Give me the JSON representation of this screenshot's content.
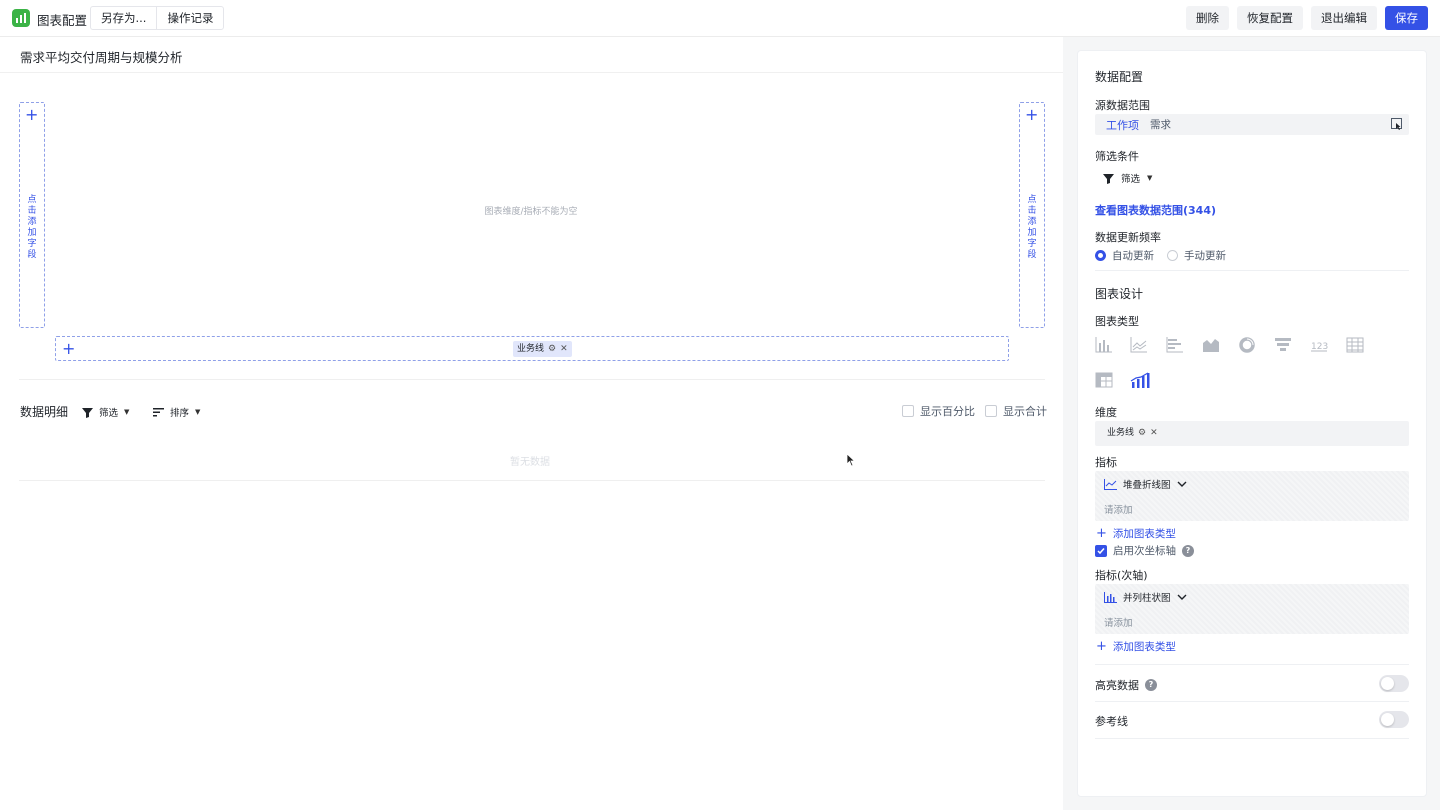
{
  "topbar": {
    "app_title": "图表配置",
    "save_as": "另存为...",
    "history": "操作记录",
    "delete": "删除",
    "restore": "恢复配置",
    "exit": "退出编辑",
    "save": "保存",
    "accent": "#3451e6"
  },
  "canvas": {
    "chart_title": "需求平均交付周期与规模分析",
    "left_axis_hint": "点击添加字段",
    "right_axis_hint": "点击添加字段",
    "empty_message": "图表维度/指标不能为空",
    "x_field_chip": "业务线"
  },
  "detail": {
    "title": "数据明细",
    "filter": "筛选",
    "sort": "排序",
    "show_percent": "显示百分比",
    "show_total": "显示合计",
    "no_data": "暂无数据"
  },
  "panel": {
    "data_config": "数据配置",
    "source_label": "源数据范围",
    "source_type": "工作项",
    "source_value": "需求",
    "filter_label": "筛选条件",
    "filter_btn": "筛选",
    "view_range": "查看图表数据范围(344)",
    "update_label": "数据更新频率",
    "auto_update": "自动更新",
    "manual_update": "手动更新",
    "chart_design": "图表设计",
    "chart_type_label": "图表类型",
    "dimension_label": "维度",
    "dimension_chip": "业务线",
    "metric_label": "指标",
    "metric_type": "堆叠折线图",
    "metric_placeholder": "请添加",
    "add_chart_type": "添加图表类型",
    "secondary_axis": "启用次坐标轴",
    "metric2_label": "指标(次轴)",
    "metric2_type": "并列柱状图",
    "metric2_placeholder": "请添加",
    "add_chart_type2": "添加图表类型",
    "highlight": "高亮数据",
    "reference_line": "参考线"
  }
}
